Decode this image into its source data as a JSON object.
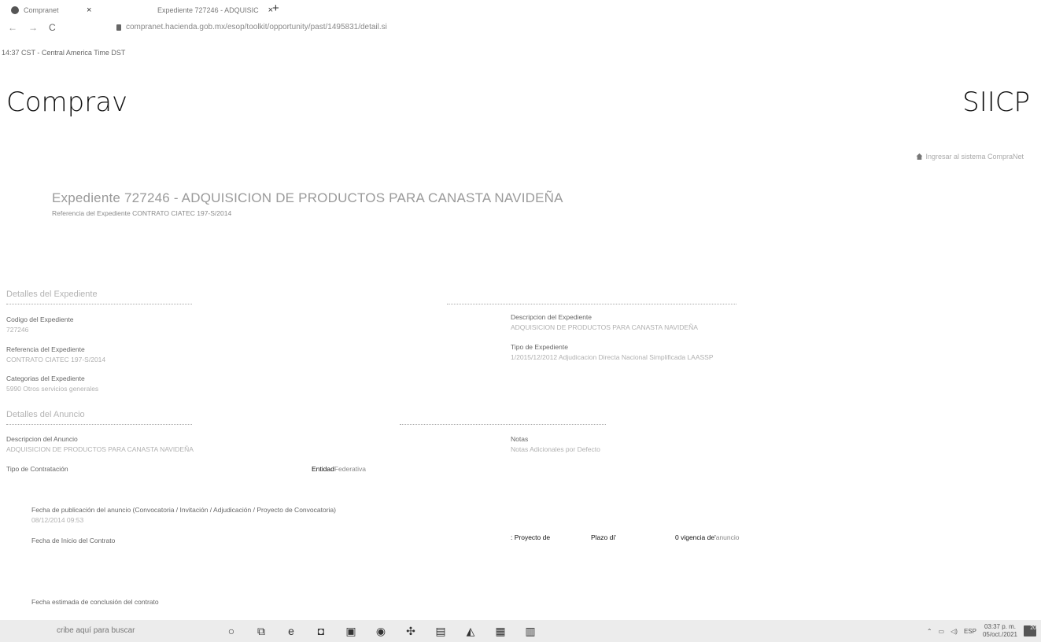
{
  "browser": {
    "tabs": [
      {
        "label": "Compranet",
        "close": "×"
      },
      {
        "label": "Expediente 727246 - ADQUISIC",
        "close": "×"
      }
    ],
    "new_tab": "+",
    "nav": {
      "back": "←",
      "forward": "→",
      "reload": "C"
    },
    "url": "compranet.hacienda.gob.mx/esop/toolkit/opportunity/past/1495831/detail.si"
  },
  "time_zone_text": "14:37 CST - Central America Time DST",
  "header": {
    "brand": "Comprav",
    "right_brand": "SIICP",
    "login_link": "Ingresar al sistema CompraNet"
  },
  "expediente": {
    "title": "Expediente 727246 - ADQUISICION DE PRODUCTOS PARA CANASTA NAVIDEÑA",
    "reference": "Referencia del Expediente CONTRATO CIATEC 197-S/2014"
  },
  "detalles_expediente": {
    "heading": "Detalles del Expediente",
    "codigo_label": "Codigo del Expediente",
    "codigo_value": "727246",
    "referencia_label": "Referencia del Expediente",
    "referencia_value": "CONTRATO CIATEC 197-S/2014",
    "categorias_label": "Categorias del Expediente",
    "categorias_value": "5990 Otros servicios generales",
    "descripcion_label": "Descripcion del Expediente",
    "descripcion_value": "ADQUISICION DE PRODUCTOS PARA CANASTA NAVIDEÑA",
    "tipo_label": "Tipo de Expediente",
    "tipo_value": "1/2015/12/2012 Adjudicacion Directa Nacional Simplificada LAASSP"
  },
  "detalles_anuncio": {
    "heading": "Detalles del Anuncio",
    "descripcion_label": "Descripcion del Anuncio",
    "descripcion_value": "ADQUISICION DE PRODUCTOS PARA CANASTA NAVIDEÑA",
    "notas_label": "Notas",
    "notas_value": "Notas Adicionales por Defecto",
    "tipo_contratacion_label": "Tipo de Contratación",
    "entidad_label_bold": "Entidad",
    "entidad_label_rest": "Federativa",
    "fecha_publicacion_label": "Fecha de publicación del anuncio (Convocatoria / Invitación / Adjudicación / Proyecto de Convocatoria)",
    "fecha_publicacion_value": "08/12/2014 09:53",
    "fecha_inicio_label": "Fecha de Inicio del Contrato",
    "proyecto_text": ": Proyecto de",
    "plazo_text": "Plazo di'",
    "vigencia_text_bold": "0 vigencia de'",
    "vigencia_text_rest": "anuncio",
    "fecha_conclusion_label": "Fecha estimada de conclusión del contrato"
  },
  "taskbar": {
    "search_placeholder": "cribe aquí para buscar",
    "icons": [
      "cortana-icon",
      "task-view-icon",
      "edge-icon",
      "outlook-icon",
      "store-icon",
      "chrome-icon",
      "app-icon",
      "mail-icon",
      "photos-icon",
      "excel-icon",
      "word-icon"
    ],
    "tray_lang": "ESP",
    "clock_time": "03:37 p. m.",
    "clock_date": "05/oct./2021",
    "notification_count": "20"
  }
}
